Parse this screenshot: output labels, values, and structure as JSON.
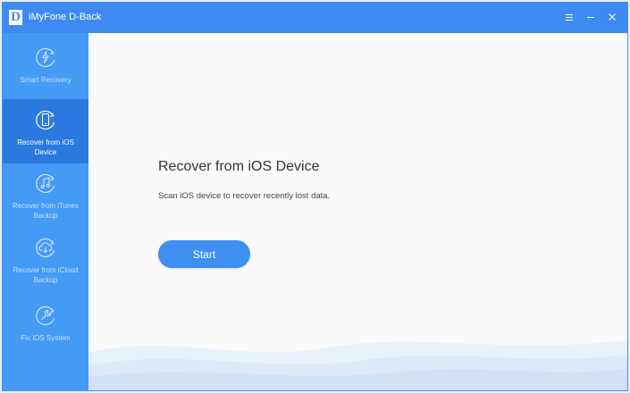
{
  "app": {
    "title": "iMyFone D-Back",
    "logo_letter": "D"
  },
  "window_controls": [
    {
      "name": "menu",
      "glyph": "≡"
    },
    {
      "name": "minimize",
      "glyph": "–"
    },
    {
      "name": "close",
      "glyph": "✕"
    }
  ],
  "sidebar": {
    "items": [
      {
        "label": "Smart Recovery",
        "icon": "lightning-refresh-icon",
        "active": false
      },
      {
        "label": "Recover from iOS Device",
        "icon": "phone-refresh-icon",
        "active": true
      },
      {
        "label": "Recover from iTunes Backup",
        "icon": "music-note-icon",
        "active": false
      },
      {
        "label": "Recover from iCloud Backup",
        "icon": "cloud-download-icon",
        "active": false
      },
      {
        "label": "Fix iOS System",
        "icon": "wrench-icon",
        "active": false
      }
    ]
  },
  "main": {
    "heading": "Recover from iOS Device",
    "description": "Scan iOS device to recover recently lost data.",
    "start_label": "Start"
  },
  "colors": {
    "accent": "#3d8bf2",
    "sidebar": "#459af5",
    "active": "#2b79df",
    "background": "#fafafa"
  }
}
